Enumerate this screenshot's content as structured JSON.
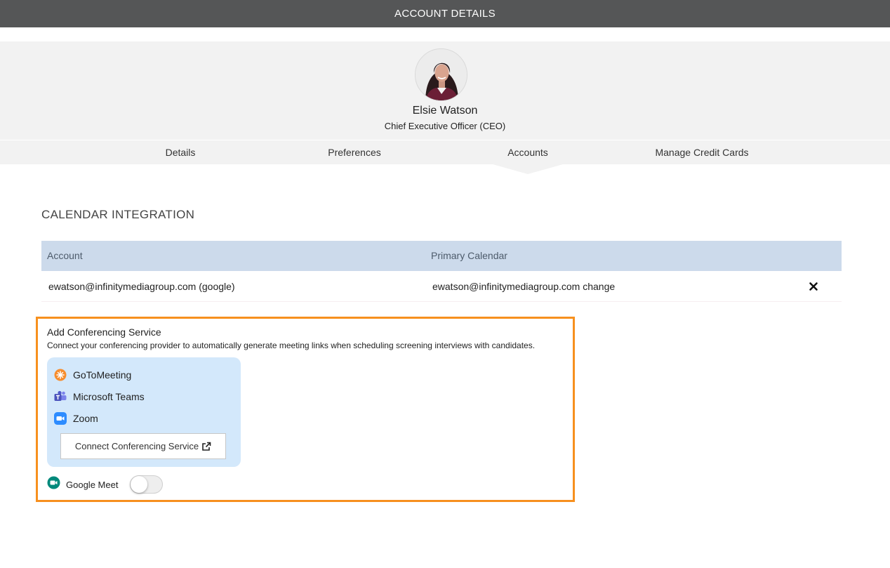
{
  "header": {
    "title": "ACCOUNT DETAILS"
  },
  "profile": {
    "name": "Elsie Watson",
    "title": "Chief Executive Officer (CEO)"
  },
  "tabs": [
    {
      "label": "Details"
    },
    {
      "label": "Preferences"
    },
    {
      "label": "Accounts",
      "active": true
    },
    {
      "label": "Manage Credit Cards"
    }
  ],
  "calendar": {
    "section_title": "CALENDAR INTEGRATION",
    "columns": {
      "account": "Account",
      "primary_calendar": "Primary Calendar"
    },
    "rows": [
      {
        "account": "ewatson@infinitymediagroup.com (google)",
        "primary_calendar": "ewatson@infinitymediagroup.com change"
      }
    ]
  },
  "conferencing": {
    "title": "Add Conferencing Service",
    "description": "Connect your conferencing provider to automatically generate meeting links when scheduling screening interviews with candidates.",
    "providers": [
      {
        "name": "GoToMeeting",
        "icon": "gotomeeting-icon"
      },
      {
        "name": "Microsoft Teams",
        "icon": "microsoft-teams-icon"
      },
      {
        "name": "Zoom",
        "icon": "zoom-icon"
      }
    ],
    "connect_label": "Connect Conferencing Service",
    "google_meet": {
      "label": "Google Meet",
      "enabled": false
    }
  },
  "colors": {
    "topbar": "#555657",
    "table_header": "#ccdaeb",
    "provider_panel": "#d3e8fb",
    "highlight_border": "#f7901e"
  }
}
